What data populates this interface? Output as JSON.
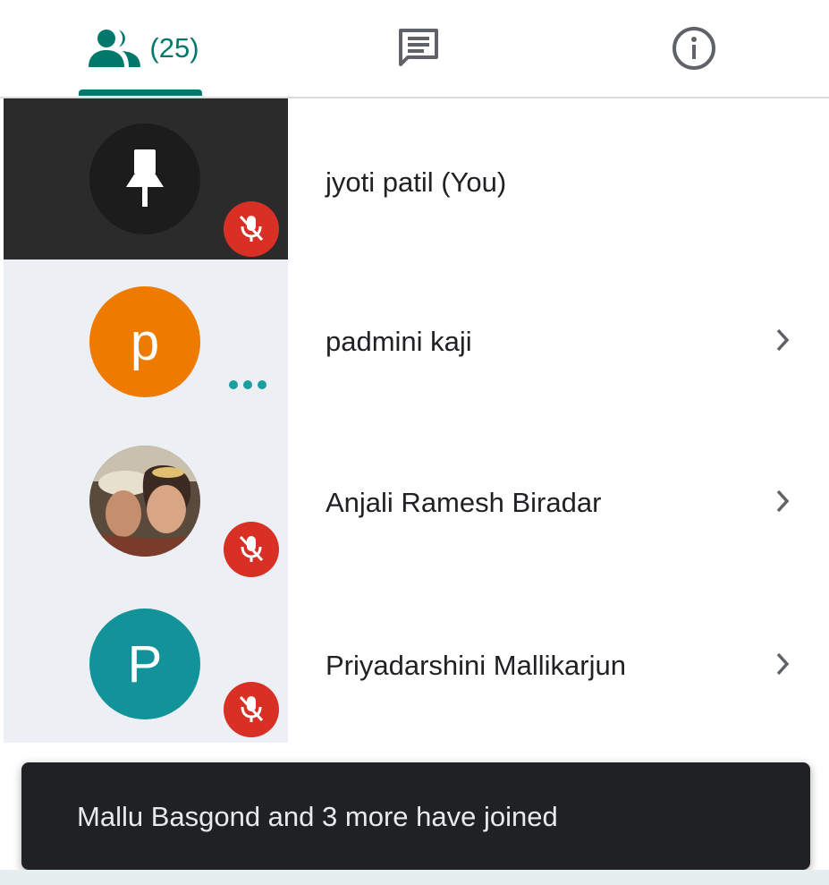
{
  "tabs": {
    "people_count": "(25)",
    "people_icon": "people-icon",
    "chat_icon": "chat-icon",
    "info_icon": "info-icon",
    "active": "people",
    "accent_color": "#00796b"
  },
  "participants": [
    {
      "name": "jyoti patil (You)",
      "avatar_type": "pin-icon",
      "mic": "muted",
      "pinned": true
    },
    {
      "name": "padmini kaji",
      "avatar_letter": "p",
      "avatar_color": "#ef7a00",
      "status": "speaking-dots"
    },
    {
      "name": "Anjali Ramesh Biradar",
      "avatar_type": "photo",
      "mic": "muted"
    },
    {
      "name": "Priyadarshini Mallikarjun",
      "avatar_letter": "P",
      "avatar_color": "#12939a",
      "mic": "muted"
    }
  ],
  "toast": {
    "message": "Mallu Basgond and 3 more have joined"
  },
  "colors": {
    "muted_badge": "#d93025",
    "pinned_bg": "#2b2b2b",
    "row_left_bg": "#eceff4"
  }
}
